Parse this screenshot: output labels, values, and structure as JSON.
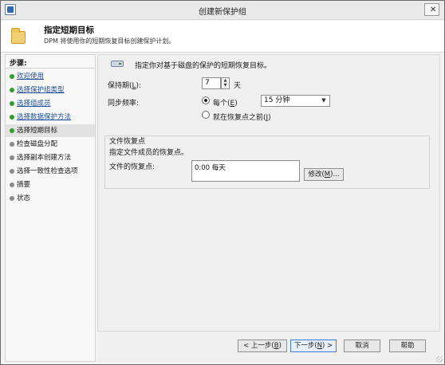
{
  "window": {
    "title": "创建新保护组",
    "close_glyph": "✕"
  },
  "header": {
    "title": "指定短期目标",
    "subtitle": "DPM 将使用你的短期恢复目标创建保护计划。",
    "icon": "folder-icon"
  },
  "steps": {
    "heading": "步骤:",
    "items": [
      {
        "label": "欢迎使用",
        "state": "done"
      },
      {
        "label": "选择保护组类型",
        "state": "done"
      },
      {
        "label": "选择组成员",
        "state": "done"
      },
      {
        "label": "选择数据保护方法",
        "state": "done"
      },
      {
        "label": "选择短期目标",
        "state": "current"
      },
      {
        "label": "检查磁盘分配",
        "state": "pending"
      },
      {
        "label": "选择副本创建方法",
        "state": "pending"
      },
      {
        "label": "选择一致性检查选项",
        "state": "pending"
      },
      {
        "label": "摘要",
        "state": "pending"
      },
      {
        "label": "状态",
        "state": "pending"
      }
    ]
  },
  "content": {
    "intro": "指定你对基于磁盘的保护的短期恢复目标。",
    "retention": {
      "label": "保持期(<u>L</u>):",
      "value": "7",
      "unit": "天"
    },
    "sync": {
      "label": "同步频率:",
      "option_every": "每个(<u>E</u>)",
      "option_every_checked": true,
      "interval_value": "15 分钟",
      "option_before": "就在恢复点之前(<u>J</u>)",
      "option_before_checked": false
    },
    "file_recovery": {
      "group_title": "文件恢复点",
      "description": "指定文件成员的恢复点。",
      "label": "文件的恢复点:",
      "schedule_text": "0:00 每天",
      "modify_button": "修改(<u>M</u>)..."
    }
  },
  "footer": {
    "back_button": "< 上一步(<u>B</u>)",
    "next_button": "下一步(<u>N</u>) >",
    "cancel_button": "取消",
    "help_button": "帮助"
  },
  "colors": {
    "link": "#1f4f9a",
    "done_dot": "#2f9e2f",
    "pending_dot": "#8a8a8a",
    "accent_border": "#3d7bd6"
  }
}
